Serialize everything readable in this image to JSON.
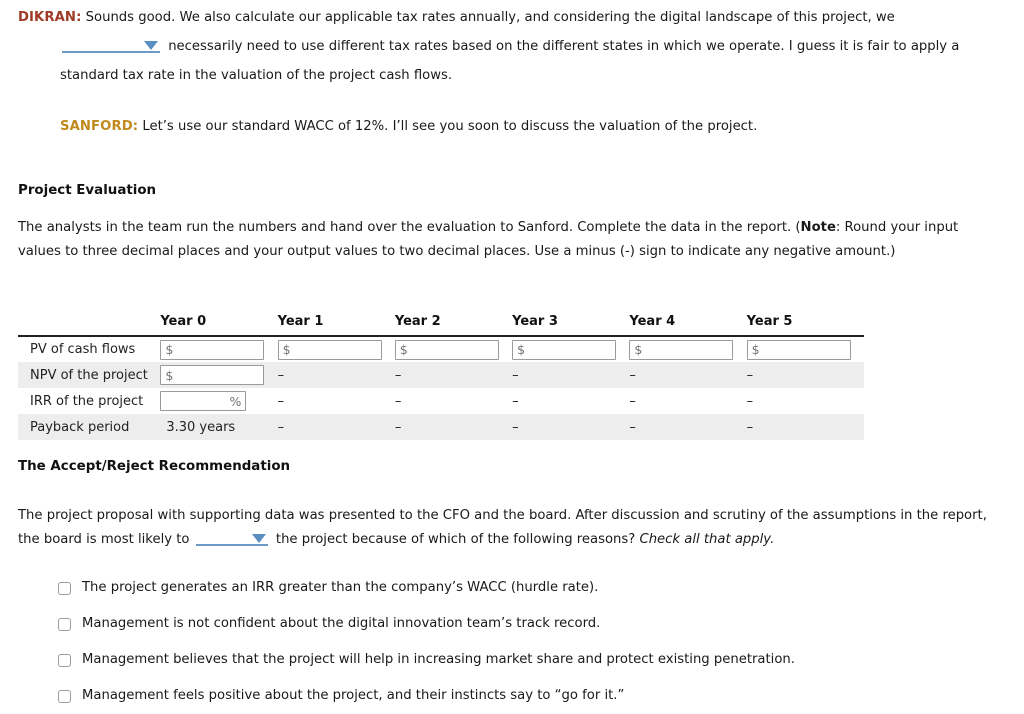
{
  "dialogue": [
    {
      "speaker": "DIKRAN:",
      "speaker_color": "#9e3a26",
      "line1": "Sounds good. We also calculate our applicable tax rates annually, and considering the digital landscape of this project, we",
      "dropdown_value": "",
      "line2": "necessarily need to use different tax rates based on the different states in which we operate. I guess it is fair to apply a",
      "line3": "standard tax rate in the valuation of the project cash flows."
    },
    {
      "speaker": "SANFORD:",
      "speaker_color": "#c08a1e",
      "line1": "Let’s use our standard WACC of 12%. I’ll see you soon to discuss the valuation of the project."
    }
  ],
  "project_evaluation": {
    "heading": "Project Evaluation",
    "intro_part1": "The analysts in the team run the numbers and hand over the evaluation to Sanford. Complete the data in the report. (",
    "intro_note_label": "Note",
    "intro_part2": ": Round your input values to three decimal places and your output values to two decimal places. Use a minus (-) sign to indicate any negative amount.)"
  },
  "table": {
    "row_label_header": "",
    "columns": [
      "Year 0",
      "Year 1",
      "Year 2",
      "Year 3",
      "Year 4",
      "Year 5"
    ],
    "rows": [
      {
        "label": "PV of cash flows",
        "shaded": false,
        "cells": [
          {
            "kind": "input",
            "value": "",
            "placeholder": "$",
            "align": "left"
          },
          {
            "kind": "input",
            "value": "",
            "placeholder": "$",
            "align": "left"
          },
          {
            "kind": "input",
            "value": "",
            "placeholder": "$",
            "align": "left"
          },
          {
            "kind": "input",
            "value": "",
            "placeholder": "$",
            "align": "left"
          },
          {
            "kind": "input",
            "value": "",
            "placeholder": "$",
            "align": "left"
          },
          {
            "kind": "input",
            "value": "",
            "placeholder": "$",
            "align": "left"
          }
        ]
      },
      {
        "label": "NPV of the project",
        "shaded": true,
        "cells": [
          {
            "kind": "input",
            "value": "",
            "placeholder": "$",
            "align": "left"
          },
          {
            "kind": "dash",
            "value": "–"
          },
          {
            "kind": "dash",
            "value": "–"
          },
          {
            "kind": "dash",
            "value": "–"
          },
          {
            "kind": "dash",
            "value": "–"
          },
          {
            "kind": "dash",
            "value": "–"
          }
        ]
      },
      {
        "label": "IRR of the project",
        "shaded": false,
        "cells": [
          {
            "kind": "input-pct",
            "value": "",
            "placeholder": "%",
            "align": "right"
          },
          {
            "kind": "dash",
            "value": "–"
          },
          {
            "kind": "dash",
            "value": "–"
          },
          {
            "kind": "dash",
            "value": "–"
          },
          {
            "kind": "dash",
            "value": "–"
          },
          {
            "kind": "dash",
            "value": "–"
          }
        ]
      },
      {
        "label": "Payback period",
        "shaded": true,
        "cells": [
          {
            "kind": "text",
            "value": "3.30 years"
          },
          {
            "kind": "dash",
            "value": "–"
          },
          {
            "kind": "dash",
            "value": "–"
          },
          {
            "kind": "dash",
            "value": "–"
          },
          {
            "kind": "dash",
            "value": "–"
          },
          {
            "kind": "dash",
            "value": "–"
          }
        ]
      }
    ]
  },
  "recommendation": {
    "heading": "The Accept/Reject Recommendation",
    "para_part1": "The project proposal with supporting data was presented to the CFO and the board. After discussion and scrutiny of the assumptions in the report, the board is most likely to",
    "dropdown_value": "",
    "para_part2": "the project because of which of the following reasons?",
    "para_italic": "Check all that apply.",
    "options": [
      {
        "checked": false,
        "label": "The project generates an IRR greater than the company’s WACC (hurdle rate)."
      },
      {
        "checked": false,
        "label": "Management is not confident about the digital innovation team’s track record."
      },
      {
        "checked": false,
        "label": "Management believes that the project will help in increasing market share and protect existing penetration."
      },
      {
        "checked": false,
        "label": "Management feels positive about the project, and their instincts say to “go for it.”"
      }
    ]
  },
  "colors": {
    "dropdown_accent": "#5b8fc2",
    "dropdown_underline": "#6b9ac7",
    "row_shade": "#ededed",
    "table_border": "#222222"
  }
}
